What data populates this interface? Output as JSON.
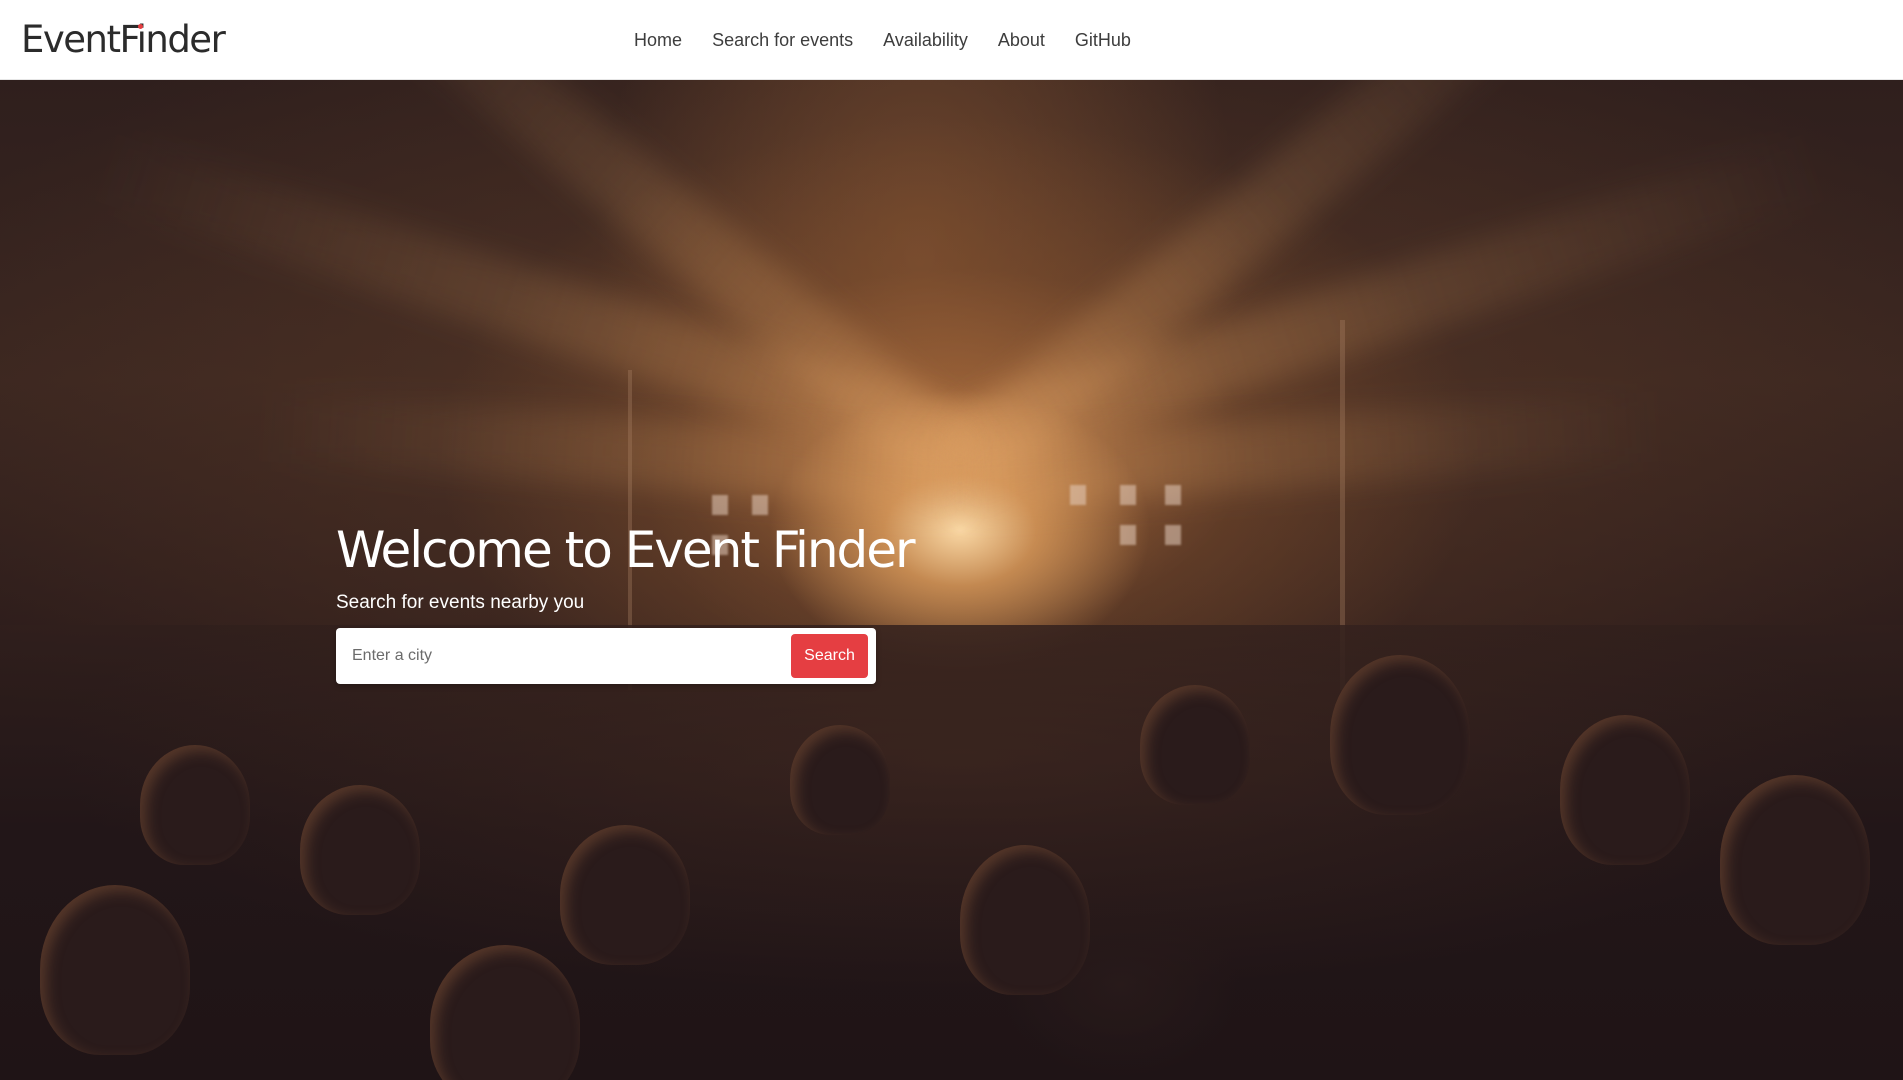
{
  "header": {
    "logo": {
      "prefix": "EventF",
      "dotted_letter": "i",
      "suffix": "nder"
    },
    "nav": [
      {
        "label": "Home"
      },
      {
        "label": "Search for events"
      },
      {
        "label": "Availability"
      },
      {
        "label": "About"
      },
      {
        "label": "GitHub"
      }
    ]
  },
  "hero": {
    "title": "Welcome to Event Finder",
    "subtitle": "Search for events nearby you",
    "search": {
      "placeholder": "Enter a city",
      "value": "",
      "button_label": "Search"
    }
  },
  "colors": {
    "accent": "#e53e42",
    "header_bg": "#ffffff",
    "hero_overlay": "#221619"
  }
}
